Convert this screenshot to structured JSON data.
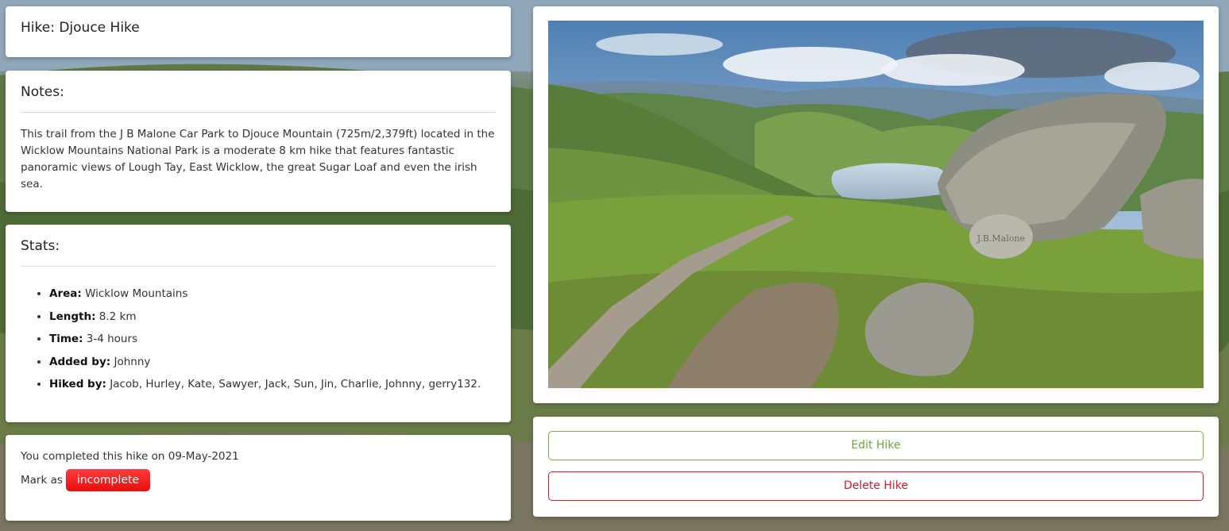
{
  "hike": {
    "title": "Hike: Djouce Hike"
  },
  "notes": {
    "heading": "Notes:",
    "text": "This trail from the J B Malone Car Park to Djouce Mountain (725m/2,379ft) located in the Wicklow Mountains National Park is a moderate 8 km hike that features fantastic panoramic views of Lough Tay, East Wicklow, the great Sugar Loaf and even the irish sea."
  },
  "stats": {
    "heading": "Stats:",
    "items": [
      {
        "label": "Area:",
        "value": "Wicklow Mountains"
      },
      {
        "label": "Length:",
        "value": "8.2 km"
      },
      {
        "label": "Time:",
        "value": "3-4 hours"
      },
      {
        "label": "Added by:",
        "value": "Johnny"
      },
      {
        "label": "Hiked by:",
        "value": "Jacob, Hurley, Kate, Sawyer, Jack, Sun, Jin, Charlie, Johnny, gerry132."
      }
    ]
  },
  "completion": {
    "message": "You completed this hike on 09-May-2021",
    "mark_as": "Mark as",
    "incomplete_label": "incomplete"
  },
  "image": {
    "stone_text": "J.B.Malone"
  },
  "actions": {
    "edit_label": "Edit Hike",
    "delete_label": "Delete Hike"
  },
  "colors": {
    "edit": "#7cb342",
    "delete": "#d9182a",
    "incomplete_bg": "#f01c1c"
  }
}
